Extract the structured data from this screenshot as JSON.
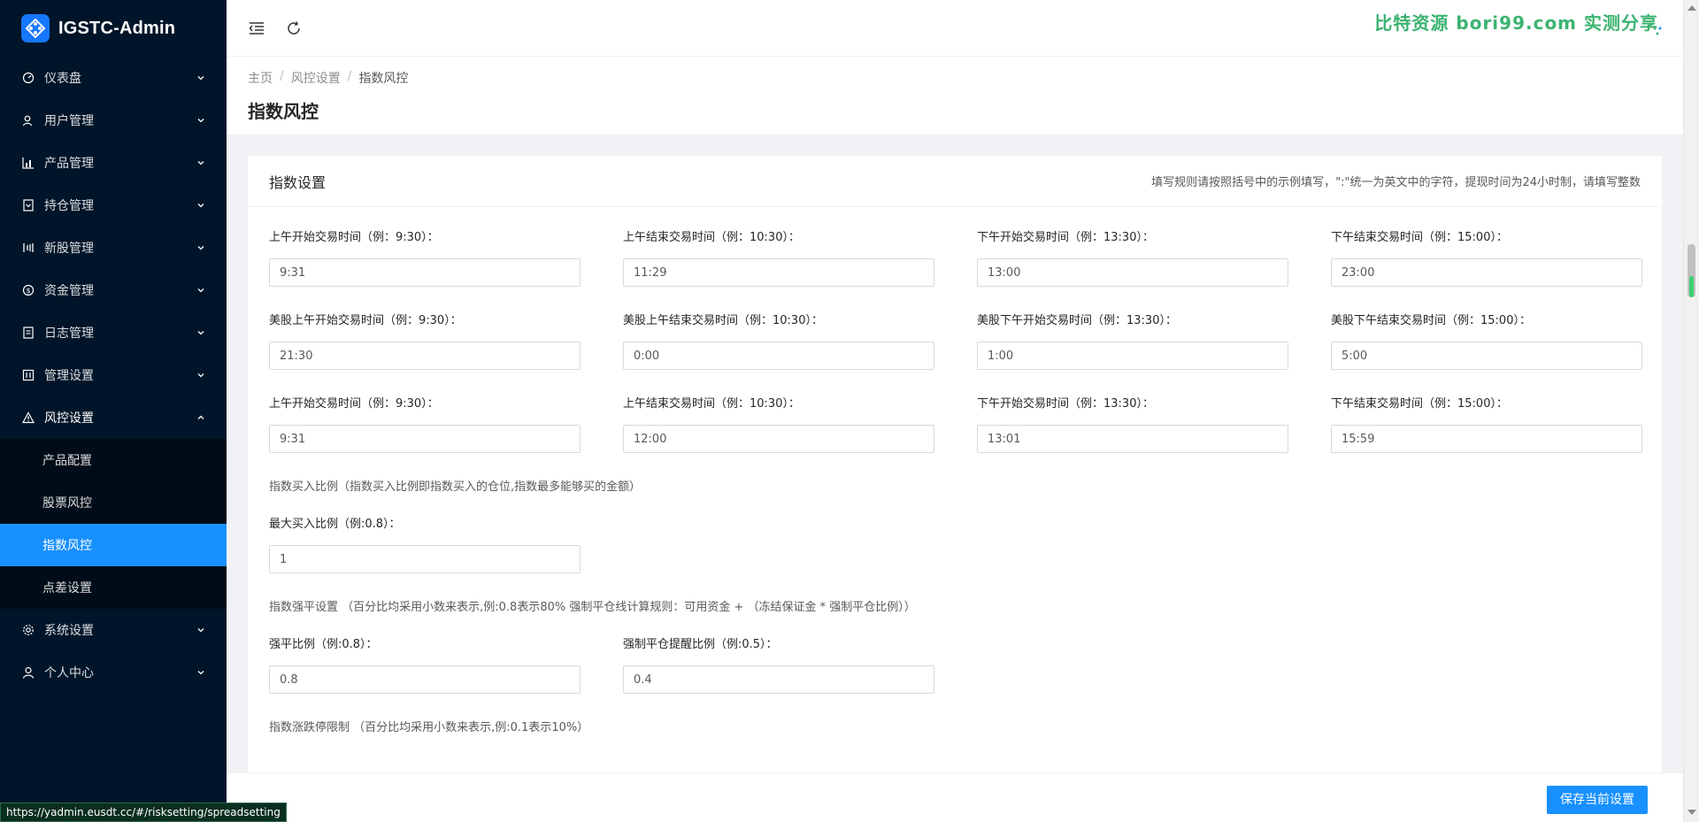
{
  "app": {
    "title": "IGSTC-Admin"
  },
  "sidebar": {
    "items": [
      {
        "label": "仪表盘",
        "icon": "dashboard-icon"
      },
      {
        "label": "用户管理",
        "icon": "user-manage-icon"
      },
      {
        "label": "产品管理",
        "icon": "chart-icon"
      },
      {
        "label": "持仓管理",
        "icon": "holdings-icon"
      },
      {
        "label": "新股管理",
        "icon": "ipo-icon"
      },
      {
        "label": "资金管理",
        "icon": "money-icon"
      },
      {
        "label": "日志管理",
        "icon": "log-icon"
      },
      {
        "label": "管理设置",
        "icon": "admin-settings-icon"
      },
      {
        "label": "风控设置",
        "icon": "warning-icon",
        "open": true
      },
      {
        "label": "系统设置",
        "icon": "settings-icon"
      },
      {
        "label": "个人中心",
        "icon": "person-icon"
      }
    ],
    "submenu": [
      "产品配置",
      "股票风控",
      "指数风控",
      "点差设置"
    ],
    "active_sub": "指数风控"
  },
  "watermark": "比特资源 bori99.com 实测分享",
  "breadcrumb": [
    "主页",
    "风控设置",
    "指数风控"
  ],
  "page_title": "指数风控",
  "card": {
    "title": "指数设置",
    "note": "填写规则请按照括号中的示例填写，\":\"统一为英文中的字符，提现时间为24小时制，请填写整数"
  },
  "rows": [
    [
      {
        "label": "上午开始交易时间（例：9:30）：",
        "value": "9:31"
      },
      {
        "label": "上午结束交易时间（例：10:30）：",
        "value": "11:29"
      },
      {
        "label": "下午开始交易时间（例：13:30）：",
        "value": "13:00"
      },
      {
        "label": "下午结束交易时间（例：15:00）：",
        "value": "23:00"
      }
    ],
    [
      {
        "label": "美股上午开始交易时间（例：9:30）：",
        "value": "21:30"
      },
      {
        "label": "美股上午结束交易时间（例：10:30）：",
        "value": "0:00"
      },
      {
        "label": "美股下午开始交易时间（例：13:30）：",
        "value": "1:00"
      },
      {
        "label": "美股下午结束交易时间（例：15:00）：",
        "value": "5:00"
      }
    ],
    [
      {
        "label": "上午开始交易时间（例：9:30）：",
        "value": "9:31"
      },
      {
        "label": "上午结束交易时间（例：10:30）：",
        "value": "12:00"
      },
      {
        "label": "下午开始交易时间（例：13:30）：",
        "value": "13:01"
      },
      {
        "label": "下午结束交易时间（例：15:00）：",
        "value": "15:59"
      }
    ]
  ],
  "buy_ratio": {
    "note": "指数买入比例（指数买入比例即指数买入的仓位,指数最多能够买的金额）",
    "max_label": "最大买入比例（例:0.8）：",
    "max_value": "1"
  },
  "force_close": {
    "note": "指数强平设置 （百分比均采用小数来表示,例:0.8表示80% 强制平仓线计算规则：可用资金 + （冻结保证金 * 强制平仓比例））",
    "ratio_label": "强平比例（例:0.8）：",
    "ratio_value": "0.8",
    "alert_label": "强制平仓提醒比例（例:0.5）：",
    "alert_value": "0.4"
  },
  "limit_note": "指数涨跌停限制 （百分比均采用小数来表示,例:0.1表示10%）",
  "footer": {
    "save_label": "保存当前设置"
  },
  "status_url": "https://yadmin.eusdt.cc/#/risksetting/spreadsetting",
  "colors": {
    "sidebar_bg": "#001529",
    "accent": "#1890ff",
    "watermark": "#3cb371"
  }
}
